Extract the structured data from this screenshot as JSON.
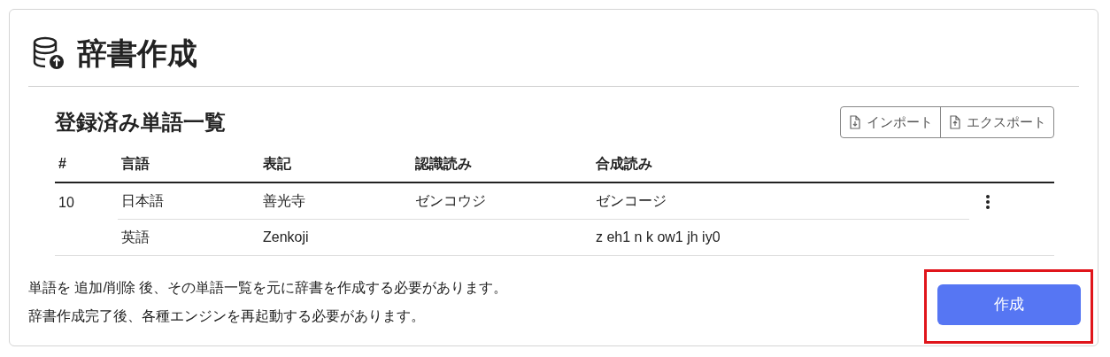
{
  "title": "辞書作成",
  "section": {
    "heading": "登録済み単語一覧",
    "actions": [
      {
        "kind": "import",
        "label": "インポート"
      },
      {
        "kind": "export",
        "label": "エクスポート"
      }
    ]
  },
  "table": {
    "columns": [
      "#",
      "言語",
      "表記",
      "認識読み",
      "合成読み"
    ],
    "rows": [
      {
        "number": "10",
        "entries": [
          {
            "language": "日本語",
            "notation": "善光寺",
            "recognition": "ゼンコウジ",
            "synthesis": "ゼンコージ"
          },
          {
            "language": "英語",
            "notation": "Zenkoji",
            "synthesis": "z eh1 n k ow1 jh iy0"
          }
        ]
      }
    ]
  },
  "notes": [
    "単語を 追加/削除 後、その単語一覧を元に辞書を作成する必要があります。",
    "辞書作成完了後、各種エンジンを再起動する必要があります。"
  ],
  "create_button": {
    "label": "作成",
    "highlighted": true
  }
}
